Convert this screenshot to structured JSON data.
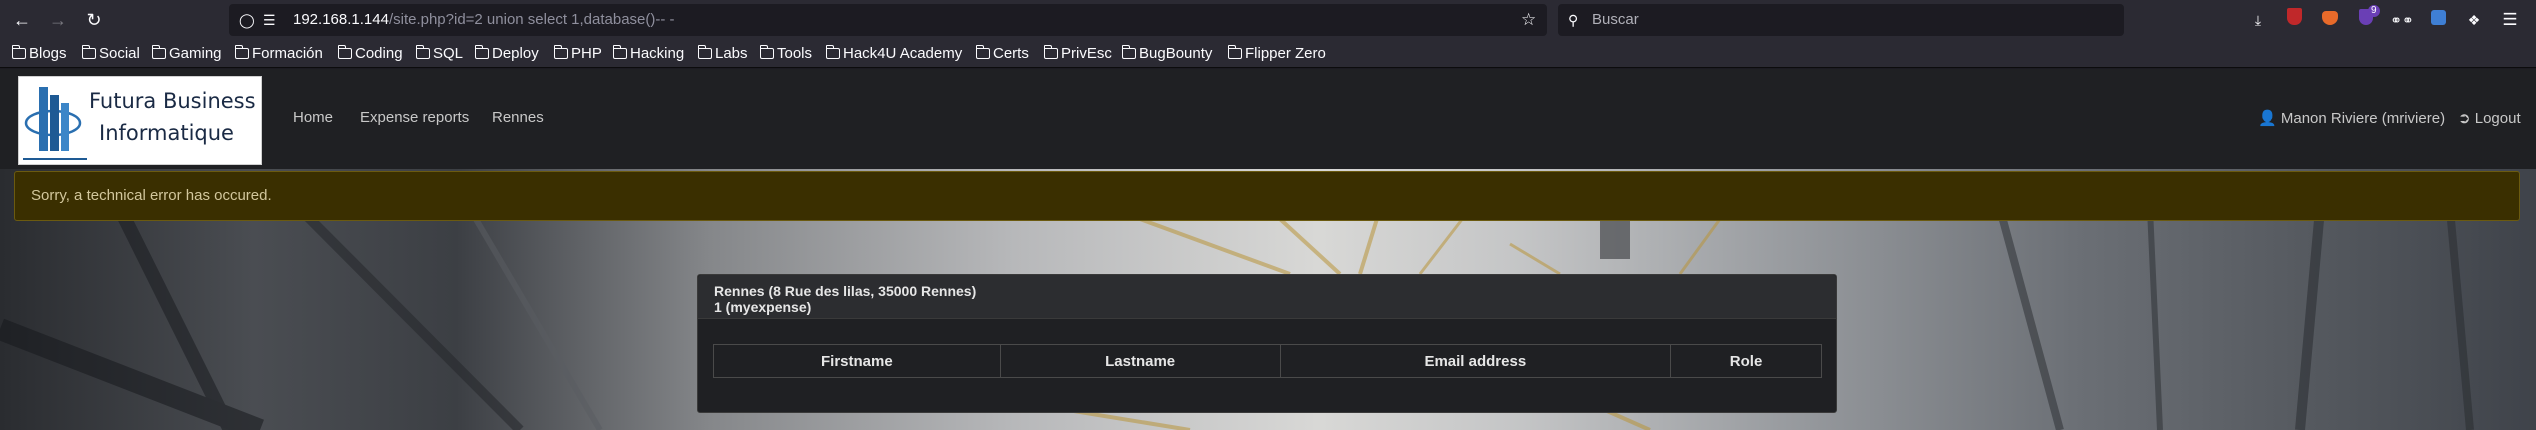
{
  "browser": {
    "url_host": "192.168.1.144",
    "url_path": "/site.php?id=2 union select 1,database()-- -",
    "search_placeholder": "Buscar",
    "extension_badge": "9",
    "bookmarks": [
      "Blogs",
      "Social",
      "Gaming",
      "Formación",
      "Coding",
      "SQL",
      "Deploy",
      "PHP",
      "Hacking",
      "Labs",
      "Tools",
      "Hack4U Academy",
      "Certs",
      "PrivEsc",
      "BugBounty",
      "Flipper Zero"
    ]
  },
  "site": {
    "logo_line1": "Futura Business",
    "logo_line2": "Informatique",
    "nav": [
      "Home",
      "Expense reports",
      "Rennes"
    ],
    "user_label": "Manon Riviere (mriviere)",
    "logout_label": "Logout"
  },
  "alert": {
    "message": "Sorry, a technical error has occured."
  },
  "card": {
    "title": "Rennes (8 Rue des lilas, 35000 Rennes)",
    "subtitle": "1 (myexpense)",
    "table": {
      "columns": [
        "Firstname",
        "Lastname",
        "Email address",
        "Role"
      ],
      "rows": []
    }
  },
  "colors": {
    "alert_bg": "#3a2f00",
    "alert_text": "#d2c79c",
    "navbar_bg": "#1f2023",
    "chrome_bg": "#2b2a33"
  },
  "icons": [
    "back-arrow-icon",
    "forward-arrow-icon",
    "reload-icon",
    "shield-icon",
    "page-info-icon",
    "bookmark-star-icon",
    "search-icon",
    "download-icon",
    "ublock-icon",
    "fox-icon",
    "shield-extension-icon",
    "glasses-icon",
    "container-icon",
    "puzzle-icon",
    "menu-icon",
    "folder-icon",
    "user-icon",
    "logout-icon"
  ]
}
